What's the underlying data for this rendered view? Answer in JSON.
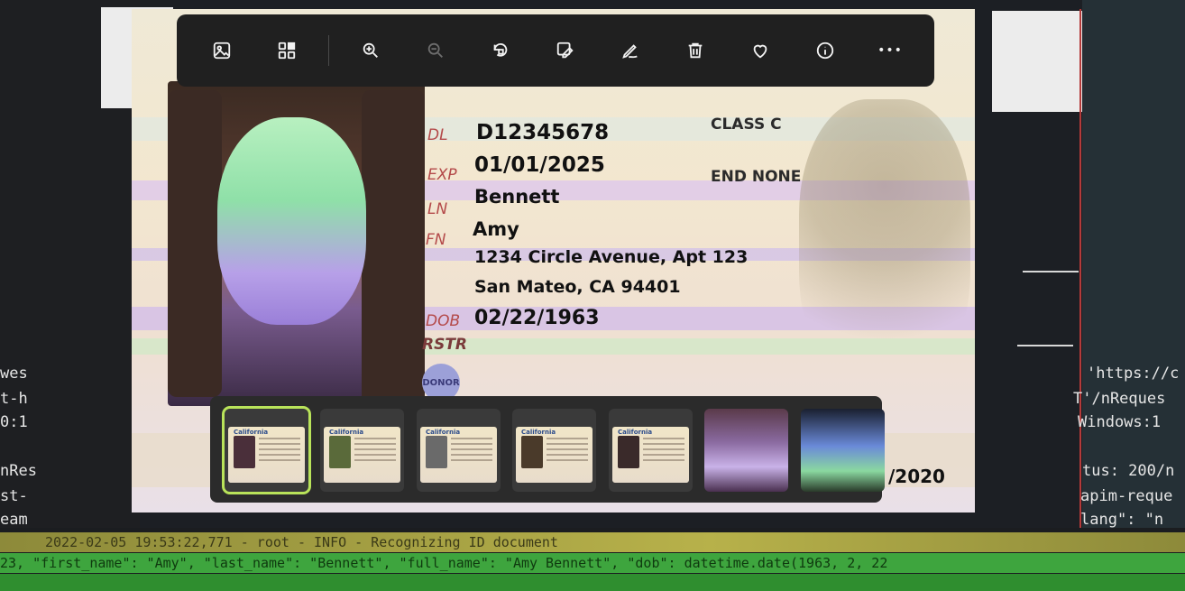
{
  "terminal": {
    "left_lines": [
      "wes",
      "t-h",
      "0:1",
      "nRes",
      "st-",
      "eam"
    ],
    "right_lines": [
      "'https://c",
      "T'/nReques",
      "Windows:1",
      "tus: 200/n",
      "apim-reque",
      "lang\": \"n"
    ]
  },
  "log": {
    "line1": "2022-02-05 19:53:22,771 - root - INFO - Recognizing ID document",
    "line2": "23, \"first_name\": \"Amy\", \"last_name\": \"Bennett\", \"full_name\": \"Amy Bennett\", \"dob\": datetime.date(1963, 2, 22"
  },
  "toolbar": {
    "items": [
      {
        "name": "image-icon",
        "label": "Image"
      },
      {
        "name": "gallery-icon",
        "label": "Gallery"
      },
      {
        "name": "zoom-in-icon",
        "label": "Zoom in"
      },
      {
        "name": "zoom-out-icon",
        "label": "Zoom out"
      },
      {
        "name": "rotate-icon",
        "label": "Rotate"
      },
      {
        "name": "edit-image-icon",
        "label": "Edit image"
      },
      {
        "name": "draw-icon",
        "label": "Draw"
      },
      {
        "name": "delete-icon",
        "label": "Delete"
      },
      {
        "name": "heart-icon",
        "label": "Favorite"
      },
      {
        "name": "info-icon",
        "label": "Info"
      },
      {
        "name": "more-icon",
        "label": "More"
      }
    ],
    "more_glyph": "•••"
  },
  "license": {
    "dl_label": "DL",
    "dl_value": "D12345678",
    "exp_label": "EXP",
    "exp_value": "01/01/2025",
    "ln_label": "LN",
    "ln_value": "Bennett",
    "fn_label": "FN",
    "fn_value": "Amy",
    "address_line1": "1234 Circle Avenue, Apt 123",
    "address_line2": "San Mateo, CA 94401",
    "dob_label": "DOB",
    "dob_value": "02/22/1963",
    "rstr_label": "RSTR",
    "class_text": "CLASS C",
    "end_text": "END NONE",
    "donor_text": "DONOR",
    "partial_year": "/2020"
  },
  "filmstrip": {
    "card_title": "California",
    "selected_index": 0
  }
}
